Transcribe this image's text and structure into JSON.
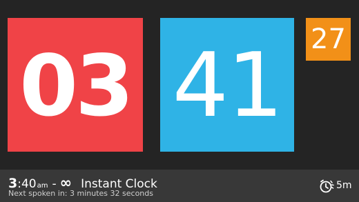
{
  "clock": {
    "hours": "03",
    "minutes": "41",
    "seconds": "27",
    "colors": {
      "hours_tile": "#f04347",
      "minutes_tile": "#2fb3e6",
      "seconds_tile": "#f29018",
      "background": "#242424",
      "notification_bar": "#383838"
    }
  },
  "notification": {
    "time_hour": "3",
    "time_minutes": ":40",
    "ampm": "am",
    "separator": "-",
    "infinity": "∞",
    "app_name": "Instant Clock",
    "next_spoken": "Next spoken in: 3 minutes 32 seconds",
    "interval_label": "5m",
    "icon": "alarm-clock-speaking-icon"
  }
}
